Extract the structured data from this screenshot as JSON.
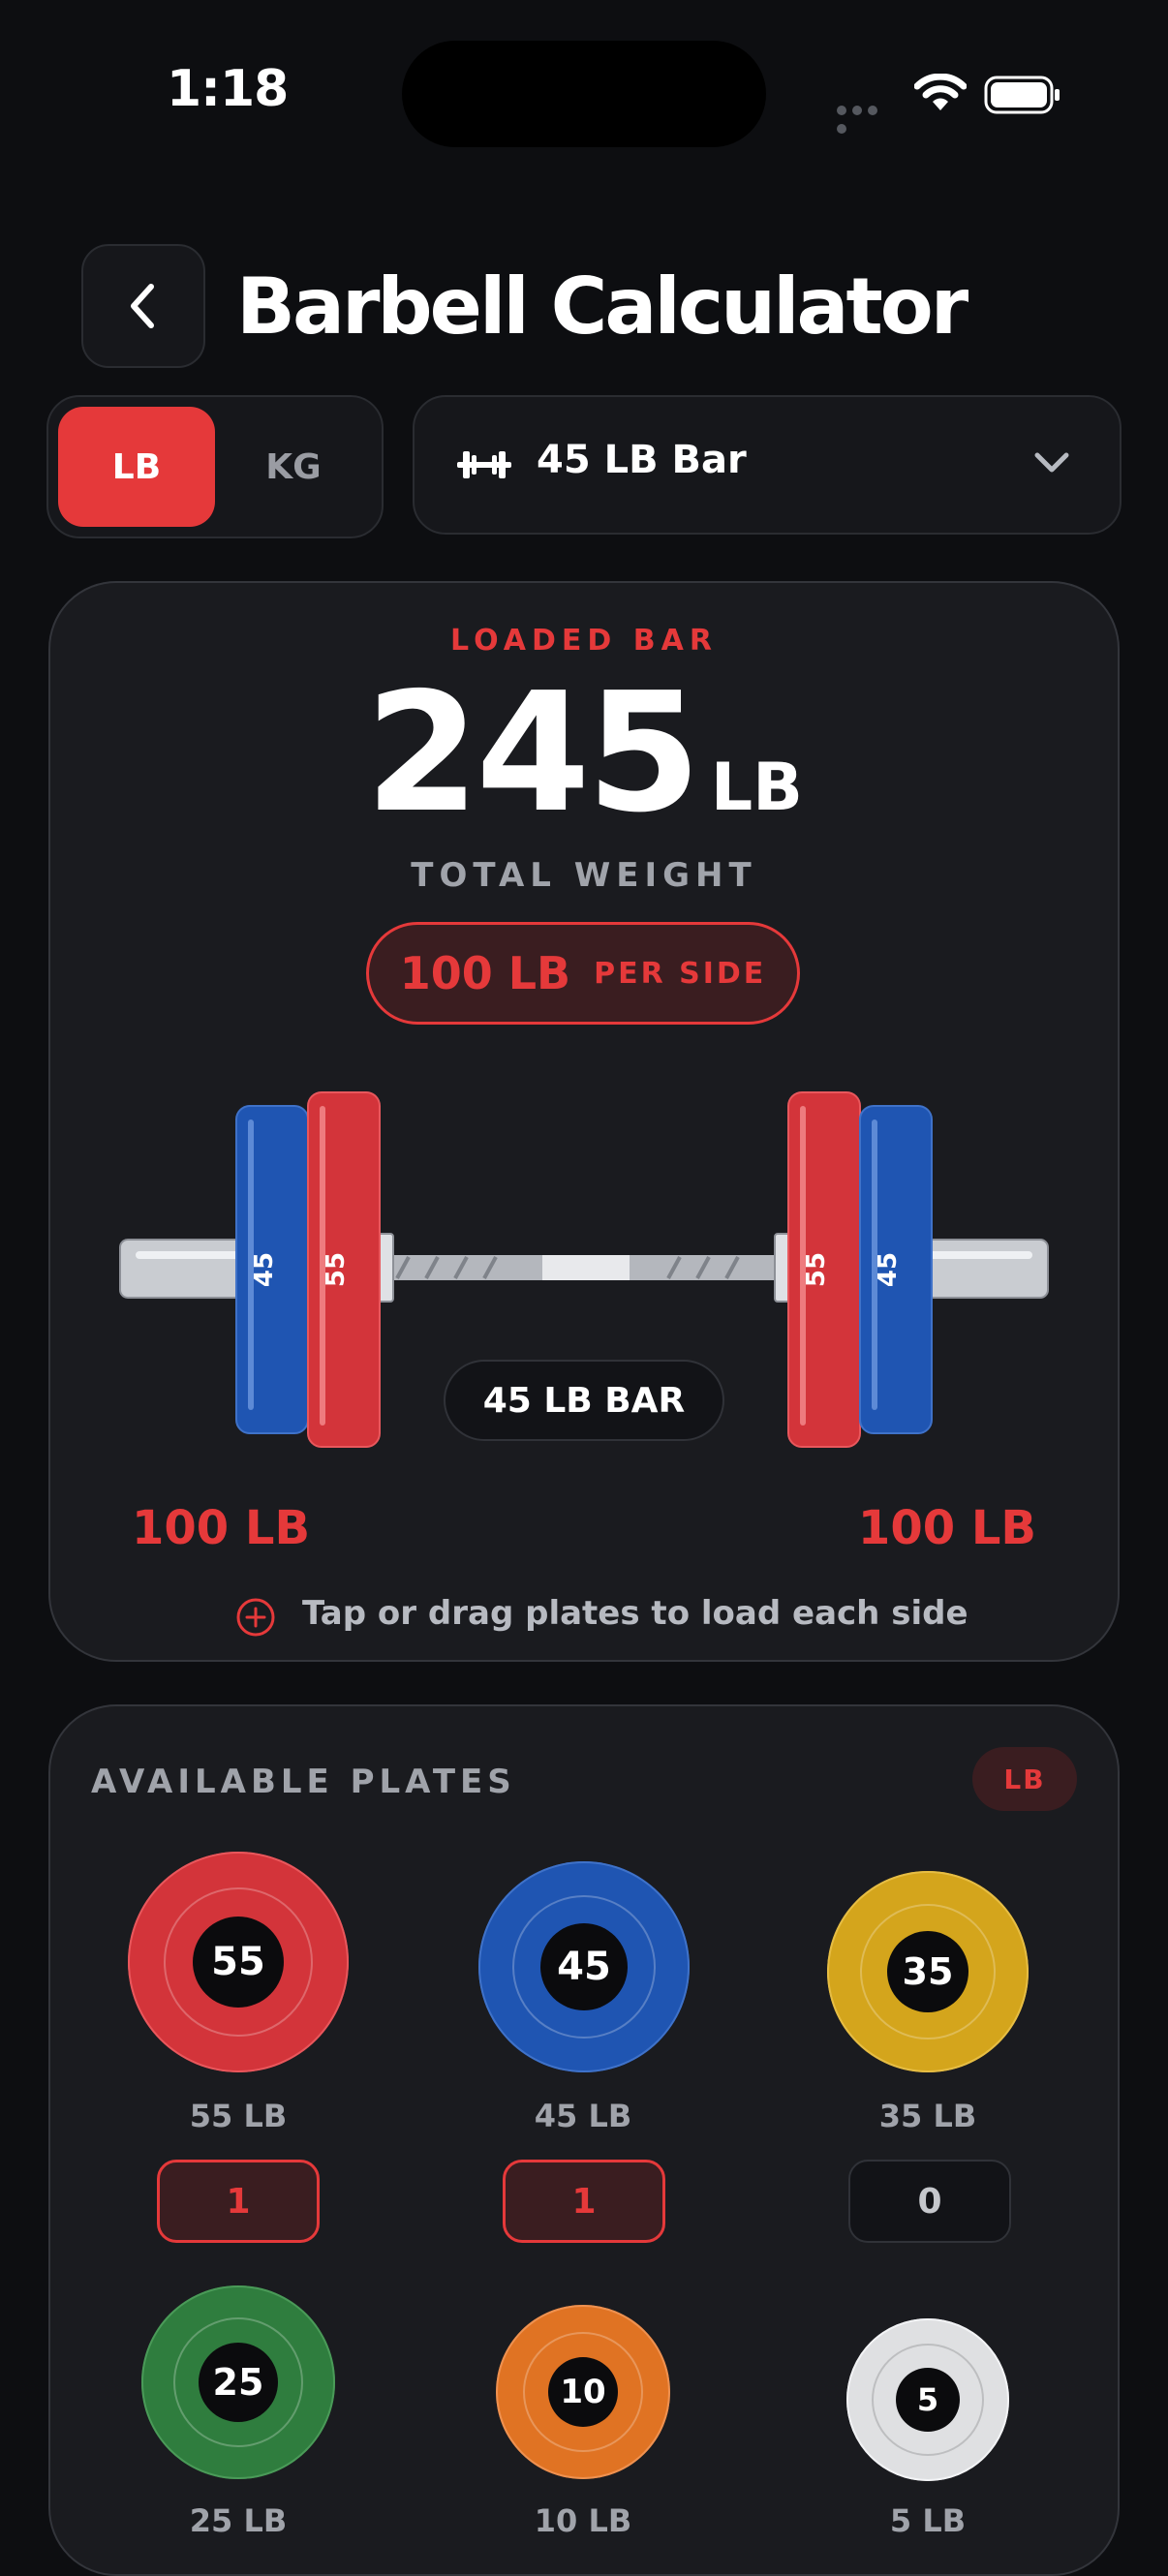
{
  "status": {
    "time": "1:18"
  },
  "header": {
    "title": "Barbell Calculator"
  },
  "units": {
    "lb": "LB",
    "kg": "KG",
    "selected": "LB"
  },
  "bar_select": {
    "label": "45 LB Bar"
  },
  "loaded": {
    "section_label": "LOADED BAR",
    "total_value": "245",
    "total_unit": "LB",
    "total_label": "TOTAL WEIGHT",
    "per_side_value": "100 LB",
    "per_side_label": "PER SIDE",
    "bar_label": "45 LB BAR",
    "left_total": "100 LB",
    "right_total": "100 LB",
    "hint": "Tap or drag plates to load each side",
    "left_plates": [
      "45",
      "55"
    ],
    "right_plates": [
      "55",
      "45"
    ]
  },
  "plates": {
    "title": "AVAILABLE PLATES",
    "unit_badge": "LB",
    "items": [
      {
        "value": "55",
        "label": "55 LB",
        "count": "1",
        "color": "#d3343a"
      },
      {
        "value": "45",
        "label": "45 LB",
        "count": "1",
        "color": "#1f55b2"
      },
      {
        "value": "35",
        "label": "35 LB",
        "count": "0",
        "color": "#d4a51c"
      },
      {
        "value": "25",
        "label": "25 LB",
        "count": "",
        "color": "#2f7d3e"
      },
      {
        "value": "10",
        "label": "10 LB",
        "count": "",
        "color": "#e07323"
      },
      {
        "value": "5",
        "label": "5 LB",
        "count": "",
        "color": "#dfe0e2"
      }
    ]
  },
  "colors": {
    "accent": "#e5393a",
    "background": "#0d0e11",
    "card": "#1a1b1f"
  }
}
